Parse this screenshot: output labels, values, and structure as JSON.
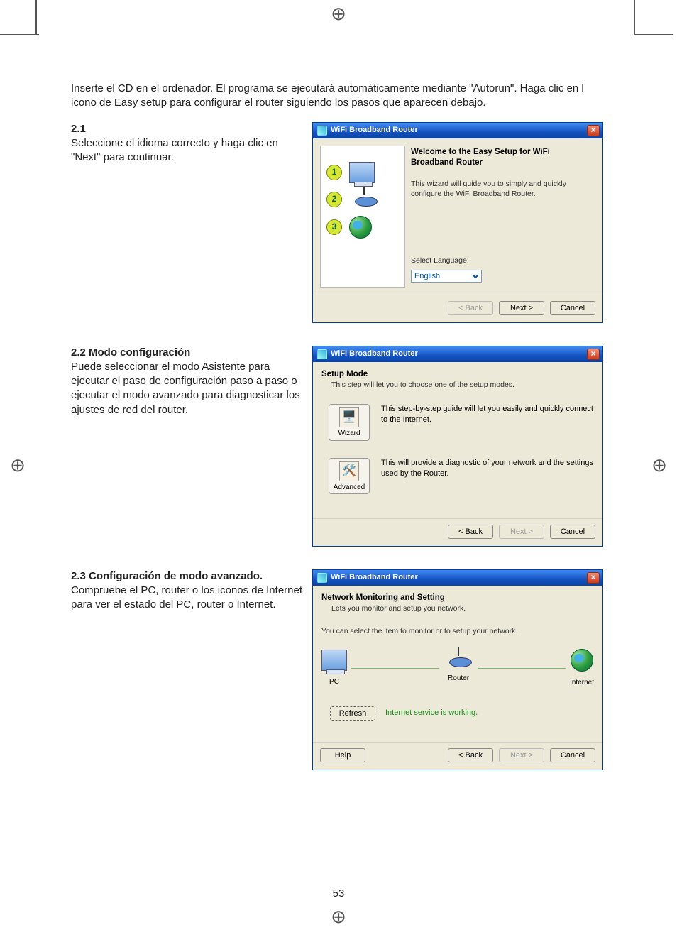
{
  "page_number": "53",
  "intro_text": "Inserte el CD en el ordenador. El programa se ejecutará automáticamente mediante \"Autorun\". Haga clic en l icono de Easy setup para configurar el router siguiendo los pasos que aparecen debajo.",
  "sections": {
    "s1": {
      "heading": "2.1",
      "body": "Seleccione el idioma correcto y haga clic en \"Next\" para continuar."
    },
    "s2": {
      "heading": "2.2 Modo configuración",
      "body": "Puede seleccionar el modo Asistente para ejecutar el paso de configuración paso a paso o ejecutar el modo avanzado para diagnosticar los ajustes de red del router."
    },
    "s3": {
      "heading": "2.3 Configuración de modo avanzado.",
      "body": "Compruebe el PC, router o los iconos de Internet para ver el estado del PC, router o Internet."
    }
  },
  "dlg_common": {
    "title": "WiFi Broadband Router",
    "close": "×",
    "back": "< Back",
    "next": "Next >",
    "cancel": "Cancel"
  },
  "dlg1": {
    "heading": "Welcome to the Easy Setup for WiFi Broadband Router",
    "intro": "This wizard will guide you to simply and quickly configure the WiFi Broadband Router.",
    "select_label": "Select Language:",
    "language_value": "English",
    "steps": [
      "1",
      "2",
      "3"
    ]
  },
  "dlg2": {
    "heading": "Setup Mode",
    "subhead": "This step will let you to choose one of the setup modes.",
    "wizard_label": "Wizard",
    "wizard_desc": "This step-by-step guide will let you easily and quickly connect to the Internet.",
    "advanced_label": "Advanced",
    "advanced_desc": "This will provide a diagnostic of your network and the settings used by the Router."
  },
  "dlg3": {
    "heading": "Network Monitoring and Setting",
    "subhead": "Lets you monitor and setup you network.",
    "instruction": "You can select the item to monitor or to setup your network.",
    "pc_label": "PC",
    "router_label": "Router",
    "internet_label": "Internet",
    "refresh": "Refresh",
    "status": "Internet service is working.",
    "help": "Help"
  }
}
